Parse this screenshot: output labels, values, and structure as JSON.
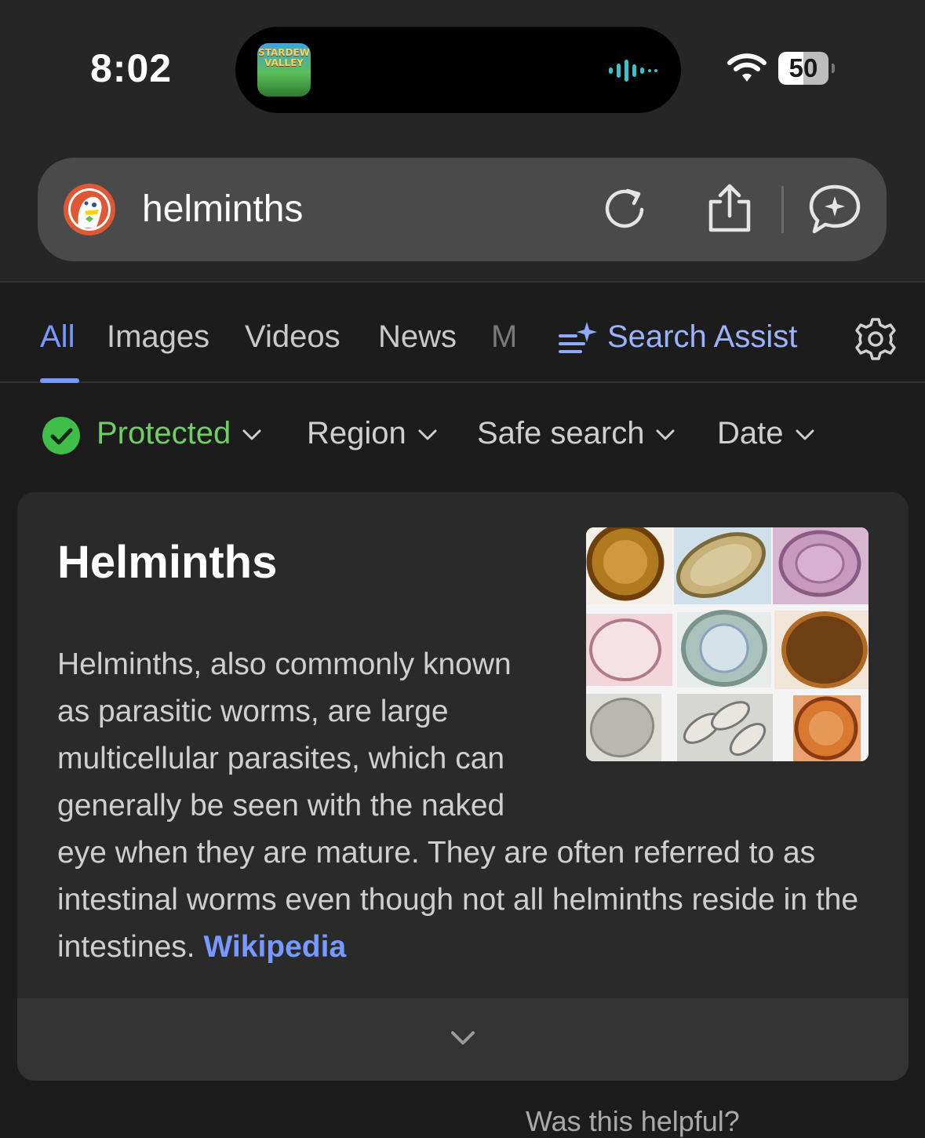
{
  "status_bar": {
    "time": "8:02",
    "app_thumb_text": "STARDEW VALLEY",
    "battery": "50",
    "battery_percent": 50,
    "icons": [
      "app-thumbnail",
      "waveform-icon",
      "wifi-icon",
      "battery-icon"
    ]
  },
  "address_bar": {
    "query": "helminths",
    "icons": [
      "duckduckgo-logo",
      "reload-icon",
      "share-icon",
      "ai-chat-icon"
    ]
  },
  "tabs": {
    "items": [
      {
        "label": "All",
        "active": true
      },
      {
        "label": "Images"
      },
      {
        "label": "Videos"
      },
      {
        "label": "News"
      },
      {
        "label": "M"
      }
    ],
    "search_assist": "Search Assist",
    "settings_icon": "gear-icon"
  },
  "filters": [
    {
      "label": "Protected",
      "icon": "check-circle-icon"
    },
    {
      "label": "Region"
    },
    {
      "label": "Safe search"
    },
    {
      "label": "Date"
    }
  ],
  "card": {
    "title": "Helminths",
    "description": "Helminths, also commonly known as parasitic worms, are large multicellular parasites, which can generally be seen with the naked eye when they are mature. They are often referred to as intestinal worms even though not all helminths reside in the intestines.",
    "source_link": "Wikipedia",
    "image_alt": "helminth-eggs-grid"
  },
  "feedback_peek": "Was this helpful?",
  "colors": {
    "accent": "#7899ff",
    "protected": "#6fcf64",
    "background": "#1c1c1c",
    "card": "#2a2a2a",
    "address_bar": "#4a4a4a"
  }
}
